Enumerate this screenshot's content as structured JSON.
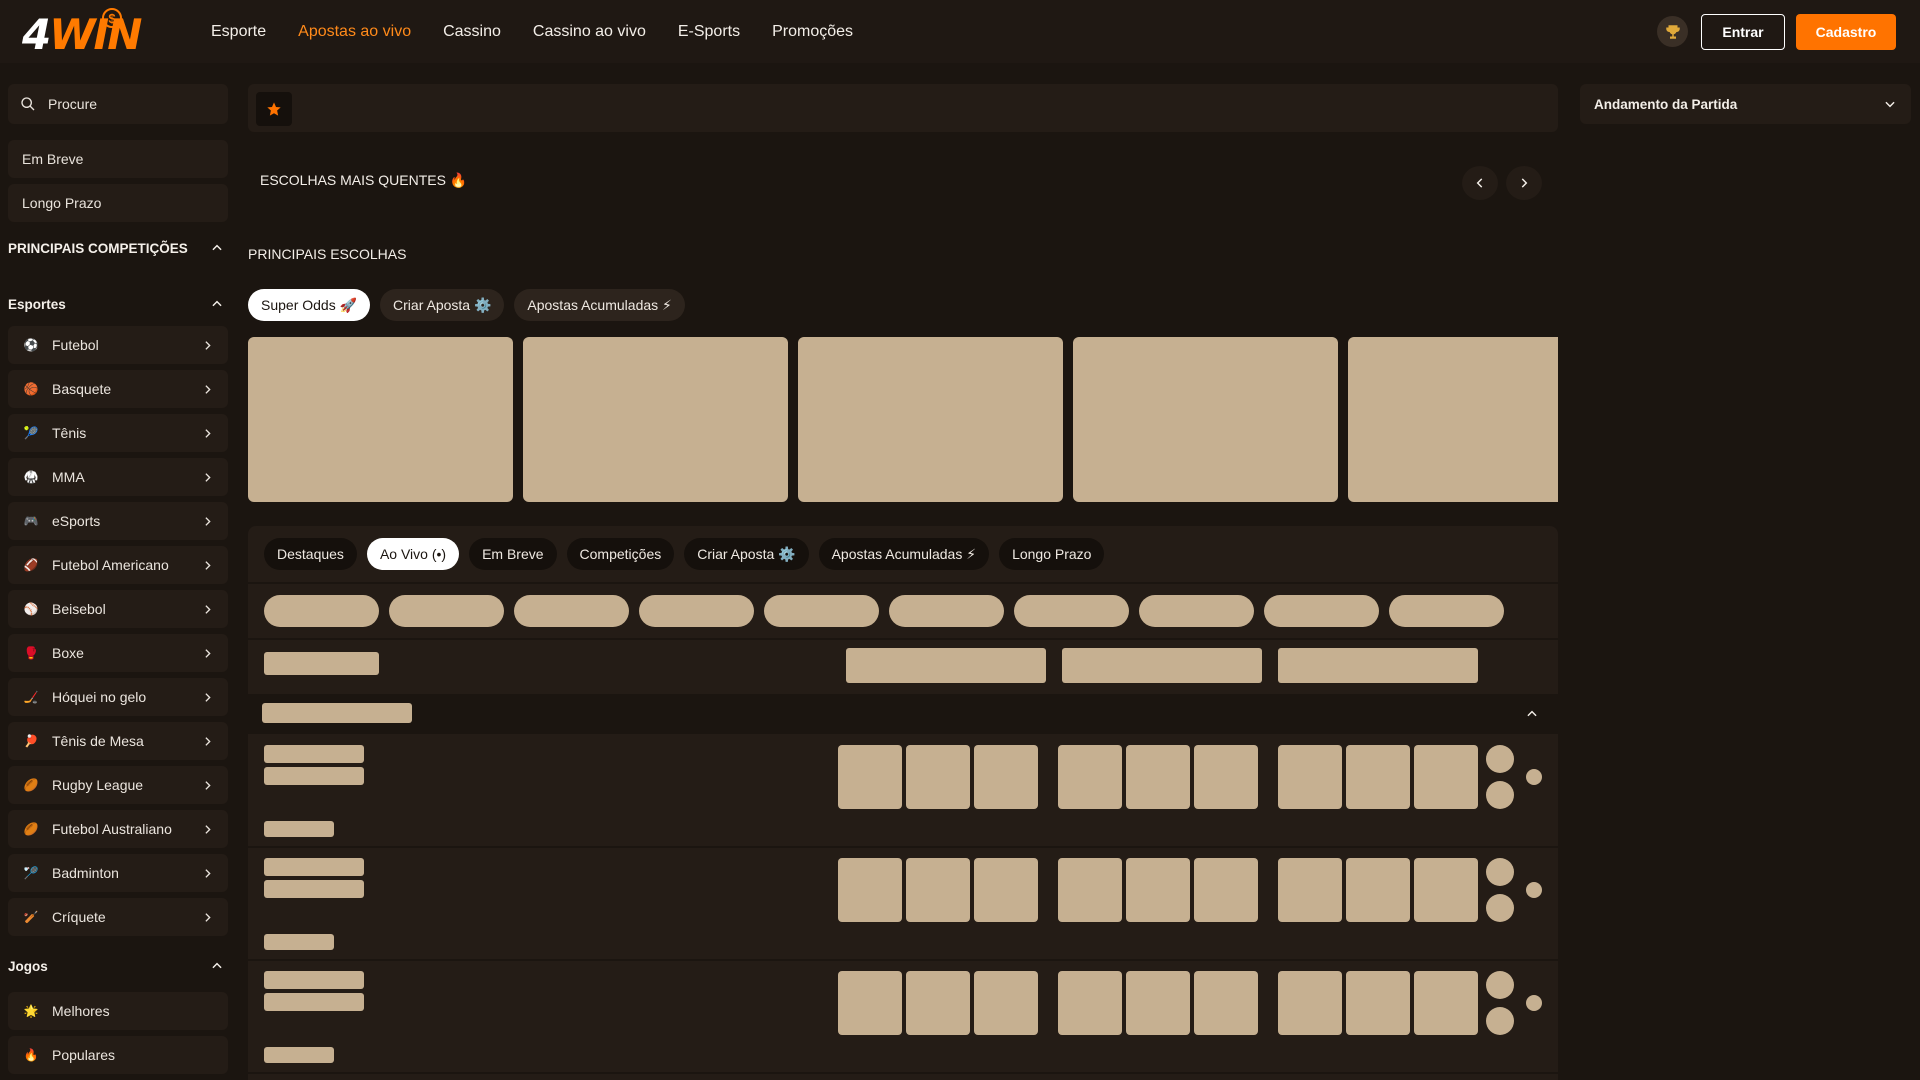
{
  "brand": {
    "logo_main": "4",
    "logo_accent": "WIN",
    "logo_coin": "$",
    "accent_color": "#ff7300",
    "skeleton_color": "#c6b091"
  },
  "nav": {
    "items": [
      "Esporte",
      "Apostas ao vivo",
      "Cassino",
      "Cassino ao vivo",
      "E-Sports",
      "Promoções"
    ],
    "active_index": 1
  },
  "header": {
    "trophy_icon": "trophy-icon",
    "login_label": "Entrar",
    "signup_label": "Cadastro"
  },
  "sidebar": {
    "search_placeholder": "Procure",
    "quick_links": [
      "Em Breve",
      "Longo Prazo"
    ],
    "top_competitions_label": "PRINCIPAIS COMPETIÇÕES",
    "sports_label": "Esportes",
    "sports": [
      {
        "label": "Futebol",
        "icon": "soccer-ball-icon",
        "glyph": "⚽"
      },
      {
        "label": "Basquete",
        "icon": "basketball-icon",
        "glyph": "🏀"
      },
      {
        "label": "Tênis",
        "icon": "tennis-ball-icon",
        "glyph": "🎾"
      },
      {
        "label": "MMA",
        "icon": "mma-icon",
        "glyph": "🥋"
      },
      {
        "label": "eSports",
        "icon": "gamepad-icon",
        "glyph": "🎮"
      },
      {
        "label": "Futebol Americano",
        "icon": "american-football-icon",
        "glyph": "🏈"
      },
      {
        "label": "Beisebol",
        "icon": "baseball-icon",
        "glyph": "⚾"
      },
      {
        "label": "Boxe",
        "icon": "boxing-glove-icon",
        "glyph": "🥊"
      },
      {
        "label": "Hóquei no gelo",
        "icon": "ice-hockey-icon",
        "glyph": "🏒"
      },
      {
        "label": "Tênis de Mesa",
        "icon": "table-tennis-icon",
        "glyph": "🏓"
      },
      {
        "label": "Rugby League",
        "icon": "rugby-ball-icon",
        "glyph": "🏉"
      },
      {
        "label": "Futebol Australiano",
        "icon": "aussie-rules-icon",
        "glyph": "🏉"
      },
      {
        "label": "Badminton",
        "icon": "shuttlecock-icon",
        "glyph": "🏸"
      },
      {
        "label": "Críquete",
        "icon": "cricket-icon",
        "glyph": "🏏"
      }
    ],
    "games_label": "Jogos",
    "games": [
      {
        "label": "Melhores",
        "icon": "star-badge-icon",
        "glyph": "🌟"
      },
      {
        "label": "Populares",
        "icon": "fire-icon",
        "glyph": "🔥"
      }
    ]
  },
  "main": {
    "hot_picks_title": "ESCOLHAS MAIS QUENTES 🔥",
    "top_picks_title": "PRINCIPAIS ESCOLHAS",
    "top_picks_chips": [
      "Super Odds 🚀",
      "Criar Aposta ⚙️",
      "Apostas Acumuladas ⚡"
    ],
    "event_tabs": [
      "Destaques",
      "Ao Vivo (•)",
      "Em Breve",
      "Competições",
      "Criar Aposta ⚙️",
      "Apostas Acumuladas ⚡",
      "Longo Prazo"
    ],
    "event_tabs_active": 1
  },
  "right_panel": {
    "title": "Andamento da Partida"
  }
}
